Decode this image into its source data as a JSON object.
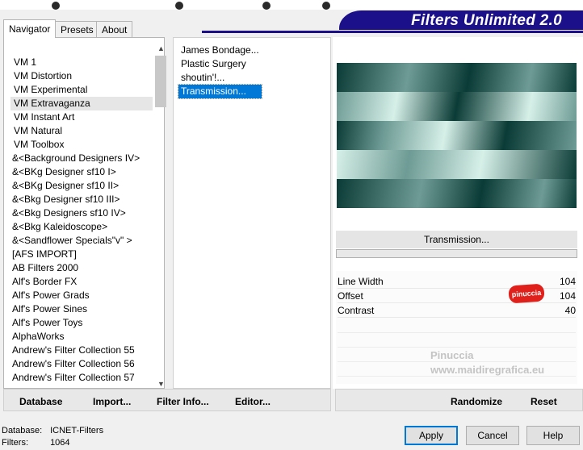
{
  "banner": {
    "title": "Filters Unlimited 2.0"
  },
  "tabs": [
    {
      "label": "Navigator"
    },
    {
      "label": "Presets"
    },
    {
      "label": "About"
    }
  ],
  "navigator": {
    "items": [
      "VM 1",
      "VM Distortion",
      "VM Experimental",
      "VM Extravaganza",
      "VM Instant Art",
      "VM Natural",
      "VM Toolbox",
      "&<Background Designers IV>",
      "&<BKg Designer sf10 I>",
      "&<BKg Designer sf10 II>",
      "&<Bkg Designer sf10 III>",
      "&<Bkg Designers sf10 IV>",
      "&<Bkg Kaleidoscope>",
      "&<Sandflower Specials\"v\" >",
      "[AFS IMPORT]",
      "AB Filters 2000",
      "Alf's Border FX",
      "Alf's Power Grads",
      "Alf's Power Sines",
      "Alf's Power Toys",
      "AlphaWorks",
      "Andrew's Filter Collection 55",
      "Andrew's Filter Collection 56",
      "Andrew's Filter Collection 57"
    ],
    "selected_index": 3
  },
  "filters": {
    "items": [
      "James Bondage...",
      "Plastic Surgery",
      "shoutin'!...",
      "Transmission..."
    ],
    "selected_index": 3
  },
  "preview": {
    "filter_title": "Transmission...",
    "colors": {
      "dark": "#0b3b36",
      "mid": "#6e9b95",
      "light": "#d6f0e8"
    }
  },
  "params": [
    {
      "label": "Line Width",
      "value": "104"
    },
    {
      "label": "Offset",
      "value": "104"
    },
    {
      "label": "Contrast",
      "value": "40"
    }
  ],
  "watermark": {
    "logo": "pinuccia",
    "name": "Pinuccia",
    "url": "www.maidiregrafica.eu"
  },
  "left_bar": {
    "database": "Database",
    "import": "Import...",
    "filter_info": "Filter Info...",
    "editor": "Editor..."
  },
  "right_bar": {
    "randomize": "Randomize",
    "reset": "Reset"
  },
  "status": {
    "database_label": "Database:",
    "database_value": "ICNET-Filters",
    "filters_label": "Filters:",
    "filters_value": "1064"
  },
  "buttons": {
    "apply": "Apply",
    "cancel": "Cancel",
    "help": "Help"
  },
  "accent_color": "#0078d7",
  "banner_color": "#1b0f8a"
}
